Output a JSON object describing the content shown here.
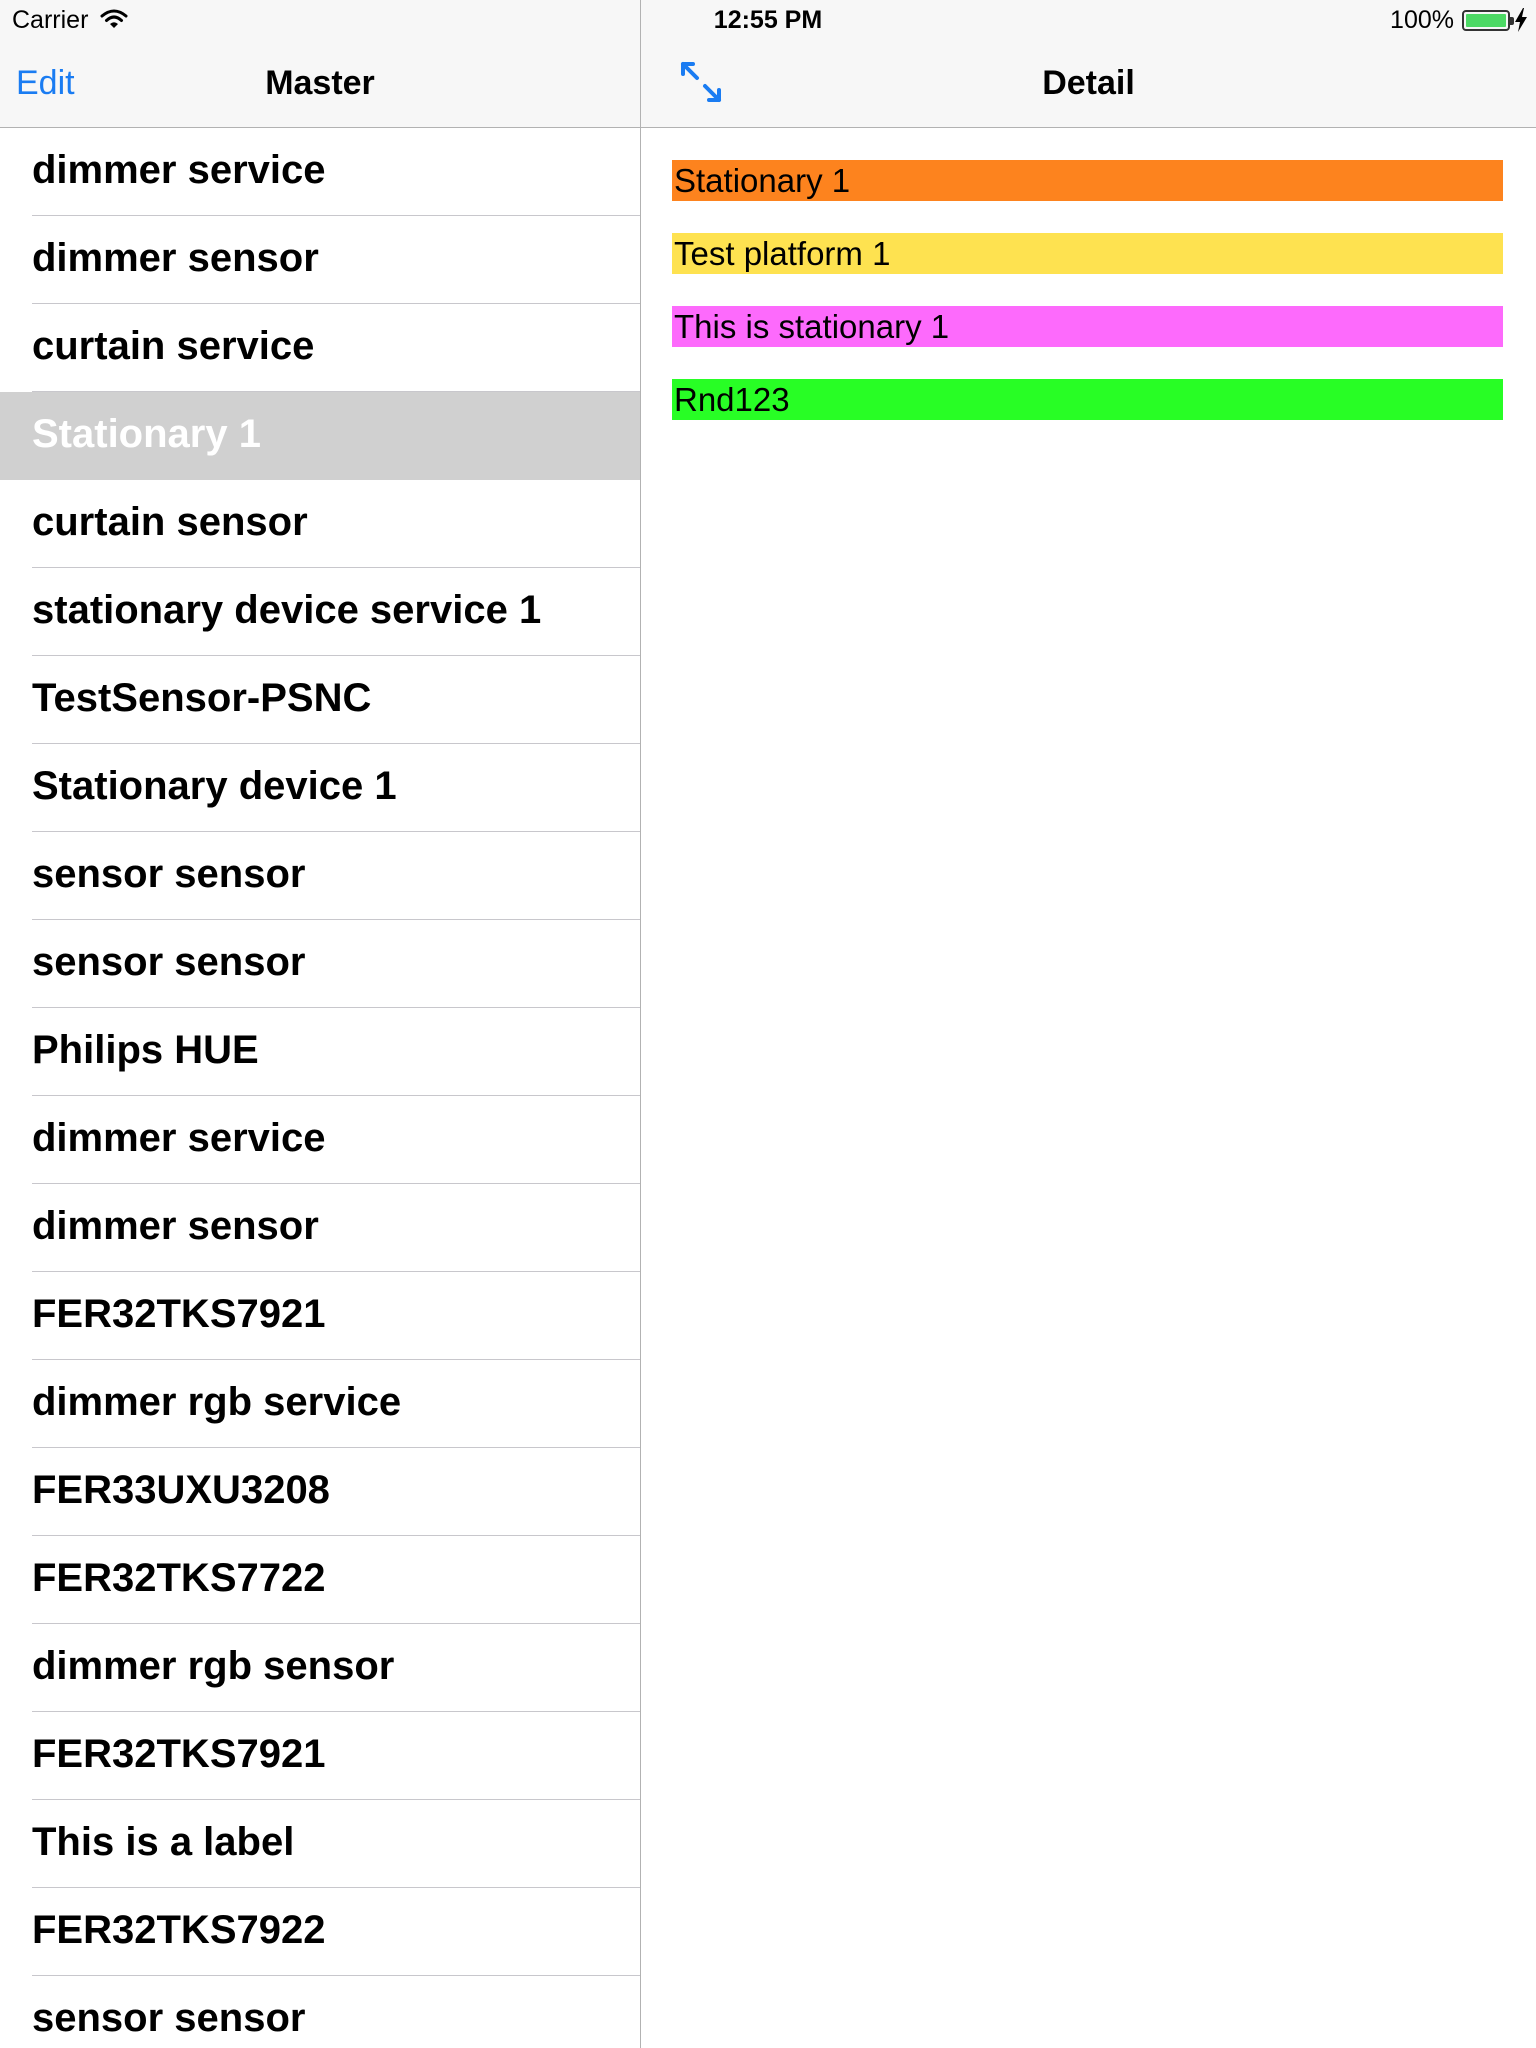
{
  "status_bar": {
    "carrier": "Carrier",
    "time": "12:55 PM",
    "battery_percent": "100%",
    "battery_level": 1.0,
    "icons": [
      "wifi-icon",
      "battery-icon",
      "charging-bolt-icon"
    ]
  },
  "master": {
    "edit_label": "Edit",
    "title": "Master",
    "selected_index": 3,
    "items": [
      {
        "label": "dimmer service"
      },
      {
        "label": "dimmer sensor"
      },
      {
        "label": "curtain service"
      },
      {
        "label": "Stationary 1"
      },
      {
        "label": "curtain sensor"
      },
      {
        "label": "stationary device service 1"
      },
      {
        "label": "TestSensor-PSNC"
      },
      {
        "label": "Stationary device 1"
      },
      {
        "label": "sensor sensor"
      },
      {
        "label": "sensor sensor"
      },
      {
        "label": "Philips HUE"
      },
      {
        "label": "dimmer service"
      },
      {
        "label": "dimmer sensor"
      },
      {
        "label": "FER32TKS7921"
      },
      {
        "label": "dimmer rgb service"
      },
      {
        "label": "FER33UXU3208"
      },
      {
        "label": "FER32TKS7722"
      },
      {
        "label": "dimmer rgb sensor"
      },
      {
        "label": "FER32TKS7921"
      },
      {
        "label": "This is a label"
      },
      {
        "label": "FER32TKS7922"
      },
      {
        "label": "sensor sensor"
      }
    ]
  },
  "detail": {
    "title": "Detail",
    "expand_icon": "expand-arrows-icon",
    "fields": [
      {
        "text": "Stationary 1",
        "color": "#fd831e"
      },
      {
        "text": "Test platform 1",
        "color": "#fee250"
      },
      {
        "text": "This is stationary 1",
        "color": "#fd6afc"
      },
      {
        "text": "Rnd123",
        "color": "#28fe25"
      }
    ]
  },
  "colors": {
    "accent": "#1a7cf2",
    "nav_background": "#f7f7f7",
    "selected_row": "#d0d0d0",
    "battery_green": "#4cd964"
  }
}
